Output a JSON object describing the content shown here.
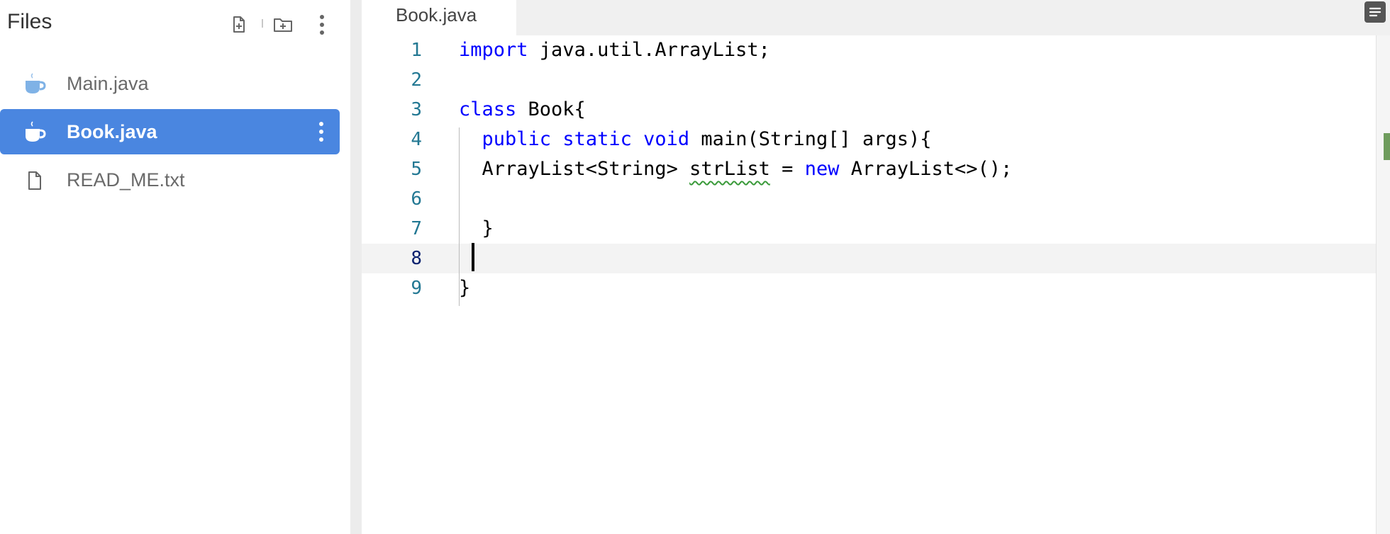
{
  "sidebar": {
    "title": "Files",
    "files": [
      {
        "label": "Main.java",
        "icon": "java-cup-icon",
        "active": false
      },
      {
        "label": "Book.java",
        "icon": "java-cup-icon",
        "active": true
      },
      {
        "label": "READ_ME.txt",
        "icon": "file-icon",
        "active": false
      }
    ]
  },
  "editor": {
    "tab_label": "Book.java",
    "current_line": 8,
    "lines": [
      {
        "num": "1",
        "code": "import java.util.ArrayList;"
      },
      {
        "num": "2",
        "code": ""
      },
      {
        "num": "3",
        "code": "class Book{"
      },
      {
        "num": "4",
        "code": "  public static void main(String[] args){"
      },
      {
        "num": "5",
        "code": "  ArrayList<String> strList = new ArrayList<>();"
      },
      {
        "num": "6",
        "code": ""
      },
      {
        "num": "7",
        "code": "  }"
      },
      {
        "num": "8",
        "code": ""
      },
      {
        "num": "9",
        "code": "}"
      }
    ],
    "warning_token": "strList"
  },
  "colors": {
    "accent": "#4a86e0",
    "keyword": "#0000ff",
    "line_number": "#237893",
    "java_icon": "#7fb2e6"
  }
}
